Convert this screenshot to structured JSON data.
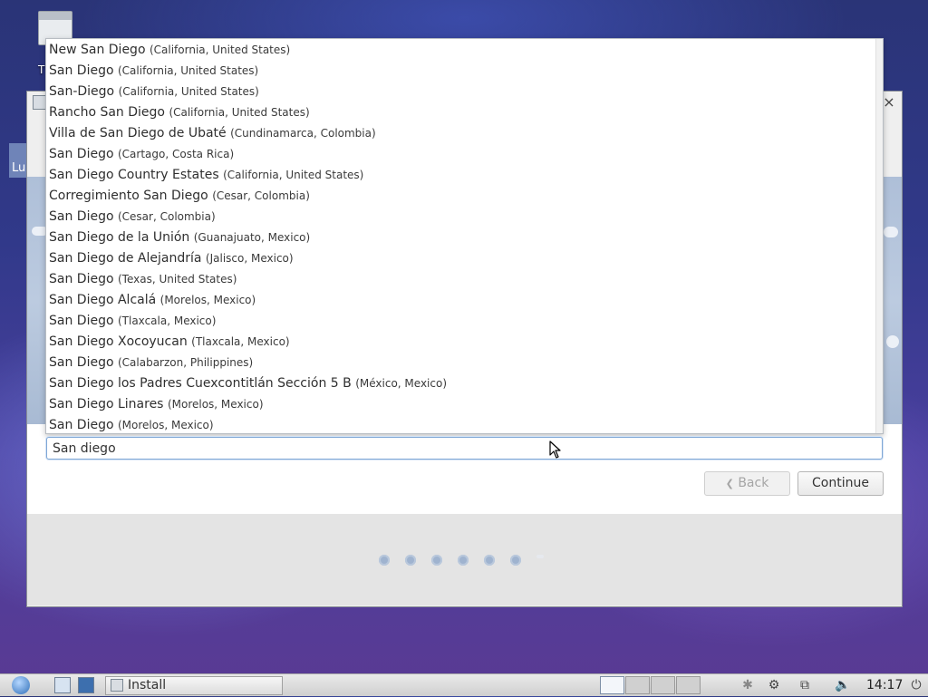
{
  "desktop": {
    "icon_label": "T",
    "side_tab_label": "Lu"
  },
  "window": {
    "close_glyph": "×"
  },
  "suggestions": [
    {
      "name": "New San Diego",
      "region": "(California, United States)"
    },
    {
      "name": "San Diego",
      "region": "(California, United States)"
    },
    {
      "name": "San-Diego",
      "region": "(California, United States)"
    },
    {
      "name": "Rancho San Diego",
      "region": "(California, United States)"
    },
    {
      "name": "Villa de San Diego de Ubaté",
      "region": "(Cundinamarca, Colombia)"
    },
    {
      "name": "San Diego",
      "region": "(Cartago, Costa Rica)"
    },
    {
      "name": "San Diego Country Estates",
      "region": "(California, United States)"
    },
    {
      "name": "Corregimiento San Diego",
      "region": "(Cesar, Colombia)"
    },
    {
      "name": "San Diego",
      "region": "(Cesar, Colombia)"
    },
    {
      "name": "San Diego de la Unión",
      "region": "(Guanajuato, Mexico)"
    },
    {
      "name": "San Diego de Alejandría",
      "region": "(Jalisco, Mexico)"
    },
    {
      "name": "San Diego",
      "region": "(Texas, United States)"
    },
    {
      "name": "San Diego Alcalá",
      "region": "(Morelos, Mexico)"
    },
    {
      "name": "San Diego",
      "region": "(Tlaxcala, Mexico)"
    },
    {
      "name": "San Diego Xocoyucan",
      "region": "(Tlaxcala, Mexico)"
    },
    {
      "name": "San Diego",
      "region": "(Calabarzon, Philippines)"
    },
    {
      "name": "San Diego los Padres Cuexcontitlán Sección 5 B",
      "region": "(México, Mexico)"
    },
    {
      "name": "San Diego Linares",
      "region": "(Morelos, Mexico)"
    },
    {
      "name": "San Diego",
      "region": "(Morelos, Mexico)"
    }
  ],
  "search": {
    "value": "San diego"
  },
  "buttons": {
    "back_label": "Back",
    "back_glyph": "❮",
    "continue_label": "Continue"
  },
  "progress": {
    "completed_steps": 6,
    "total_steps": 7
  },
  "taskbar": {
    "task_label": "Install",
    "clock": "14:17",
    "tray_icons": [
      "bluetooth-icon",
      "network-manager-icon",
      "network-icon",
      "volume-icon",
      "power-icon"
    ]
  },
  "colors": {
    "accent": "#7fa7d6",
    "window_bg": "#efefef"
  }
}
